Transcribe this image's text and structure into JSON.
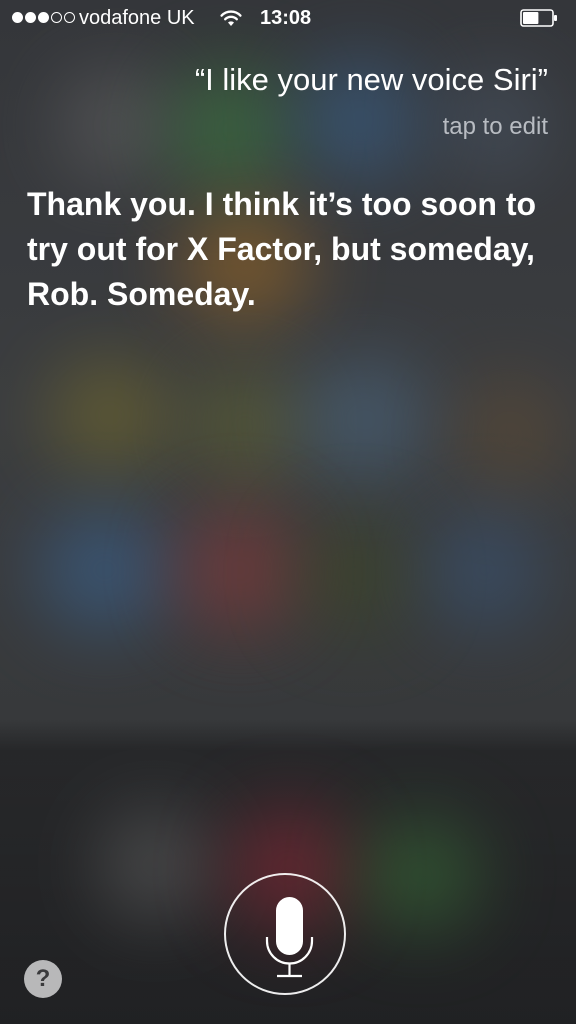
{
  "status_bar": {
    "signal_bars_filled": 3,
    "signal_bars_total": 5,
    "carrier": "vodafone UK",
    "wifi_icon": "wifi-icon",
    "time": "13:08",
    "battery_level": 0.55,
    "battery_icon": "battery-icon"
  },
  "siri": {
    "query": "“I like your new voice Siri”",
    "tap_to_edit": "tap to edit",
    "response": "Thank you. I think it’s too soon to try out for X Factor, but someday, Rob. Someday."
  },
  "controls": {
    "mic_icon": "microphone-icon",
    "help_label": "?"
  }
}
